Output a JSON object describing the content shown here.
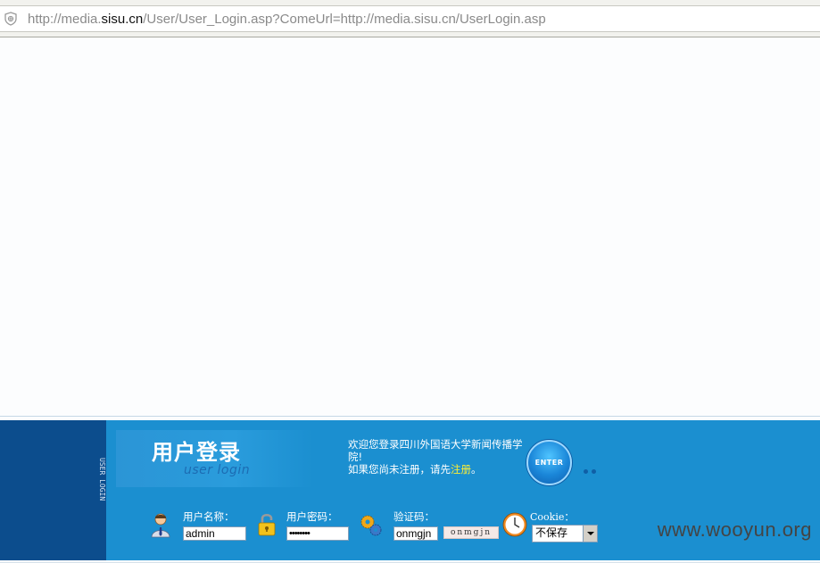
{
  "browser": {
    "url_prefix": "http://media.",
    "url_host": "sisu.cn",
    "url_rest": "/User/User_Login.asp?ComeUrl=http://media.sisu.cn/UserLogin.asp"
  },
  "login": {
    "side_label": "USER LOGIN",
    "title": "用户登录",
    "subtitle": "user login",
    "welcome_line1": "欢迎您登录四川外国语大学新闻传播学院!",
    "welcome_line2_prefix": "如果您尚未注册，请先",
    "register_link": "注册",
    "welcome_line2_suffix": "。",
    "enter_label": "ENTER",
    "username_label": "用户名称：",
    "username_value": "admin",
    "password_label": "用户密码：",
    "password_value": "••••••••",
    "captcha_label": "验证码：",
    "captcha_value": "onmgjn",
    "captcha_image_text": "onmgjn",
    "cookie_label": "Cookie：",
    "cookie_selected": "不保存"
  },
  "watermark": "www.wooyun.org",
  "colors": {
    "strip_blue": "#1b8fd0",
    "side_navy": "#0c4d8d",
    "link_yellow": "#ffee33"
  }
}
